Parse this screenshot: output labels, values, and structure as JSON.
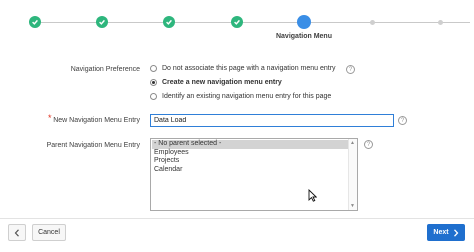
{
  "wizard": {
    "current_step_label": "Navigation Menu",
    "completed_steps": 4,
    "accent_complete": "#2eb67d",
    "accent_current": "#3a8ee6"
  },
  "form": {
    "nav_preference": {
      "label": "Navigation Preference",
      "options": [
        "Do not associate this page with a navigation menu entry",
        "Create a new navigation menu entry",
        "Identify an existing navigation menu entry for this page"
      ],
      "selected_index": 1
    },
    "new_entry": {
      "label": "New Navigation Menu Entry",
      "value": "Data Load",
      "required": true
    },
    "parent_entry": {
      "label": "Parent Navigation Menu Entry",
      "options": [
        "- No parent selected -",
        "Employees",
        "Projects",
        "Calendar"
      ],
      "selected_index": 0
    },
    "help_icon_glyph": "?"
  },
  "footer": {
    "back_icon": "chevron-left-icon",
    "cancel_label": "Cancel",
    "next_label": "Next",
    "next_icon": "chevron-right-icon",
    "next_color": "#1f6fce"
  }
}
